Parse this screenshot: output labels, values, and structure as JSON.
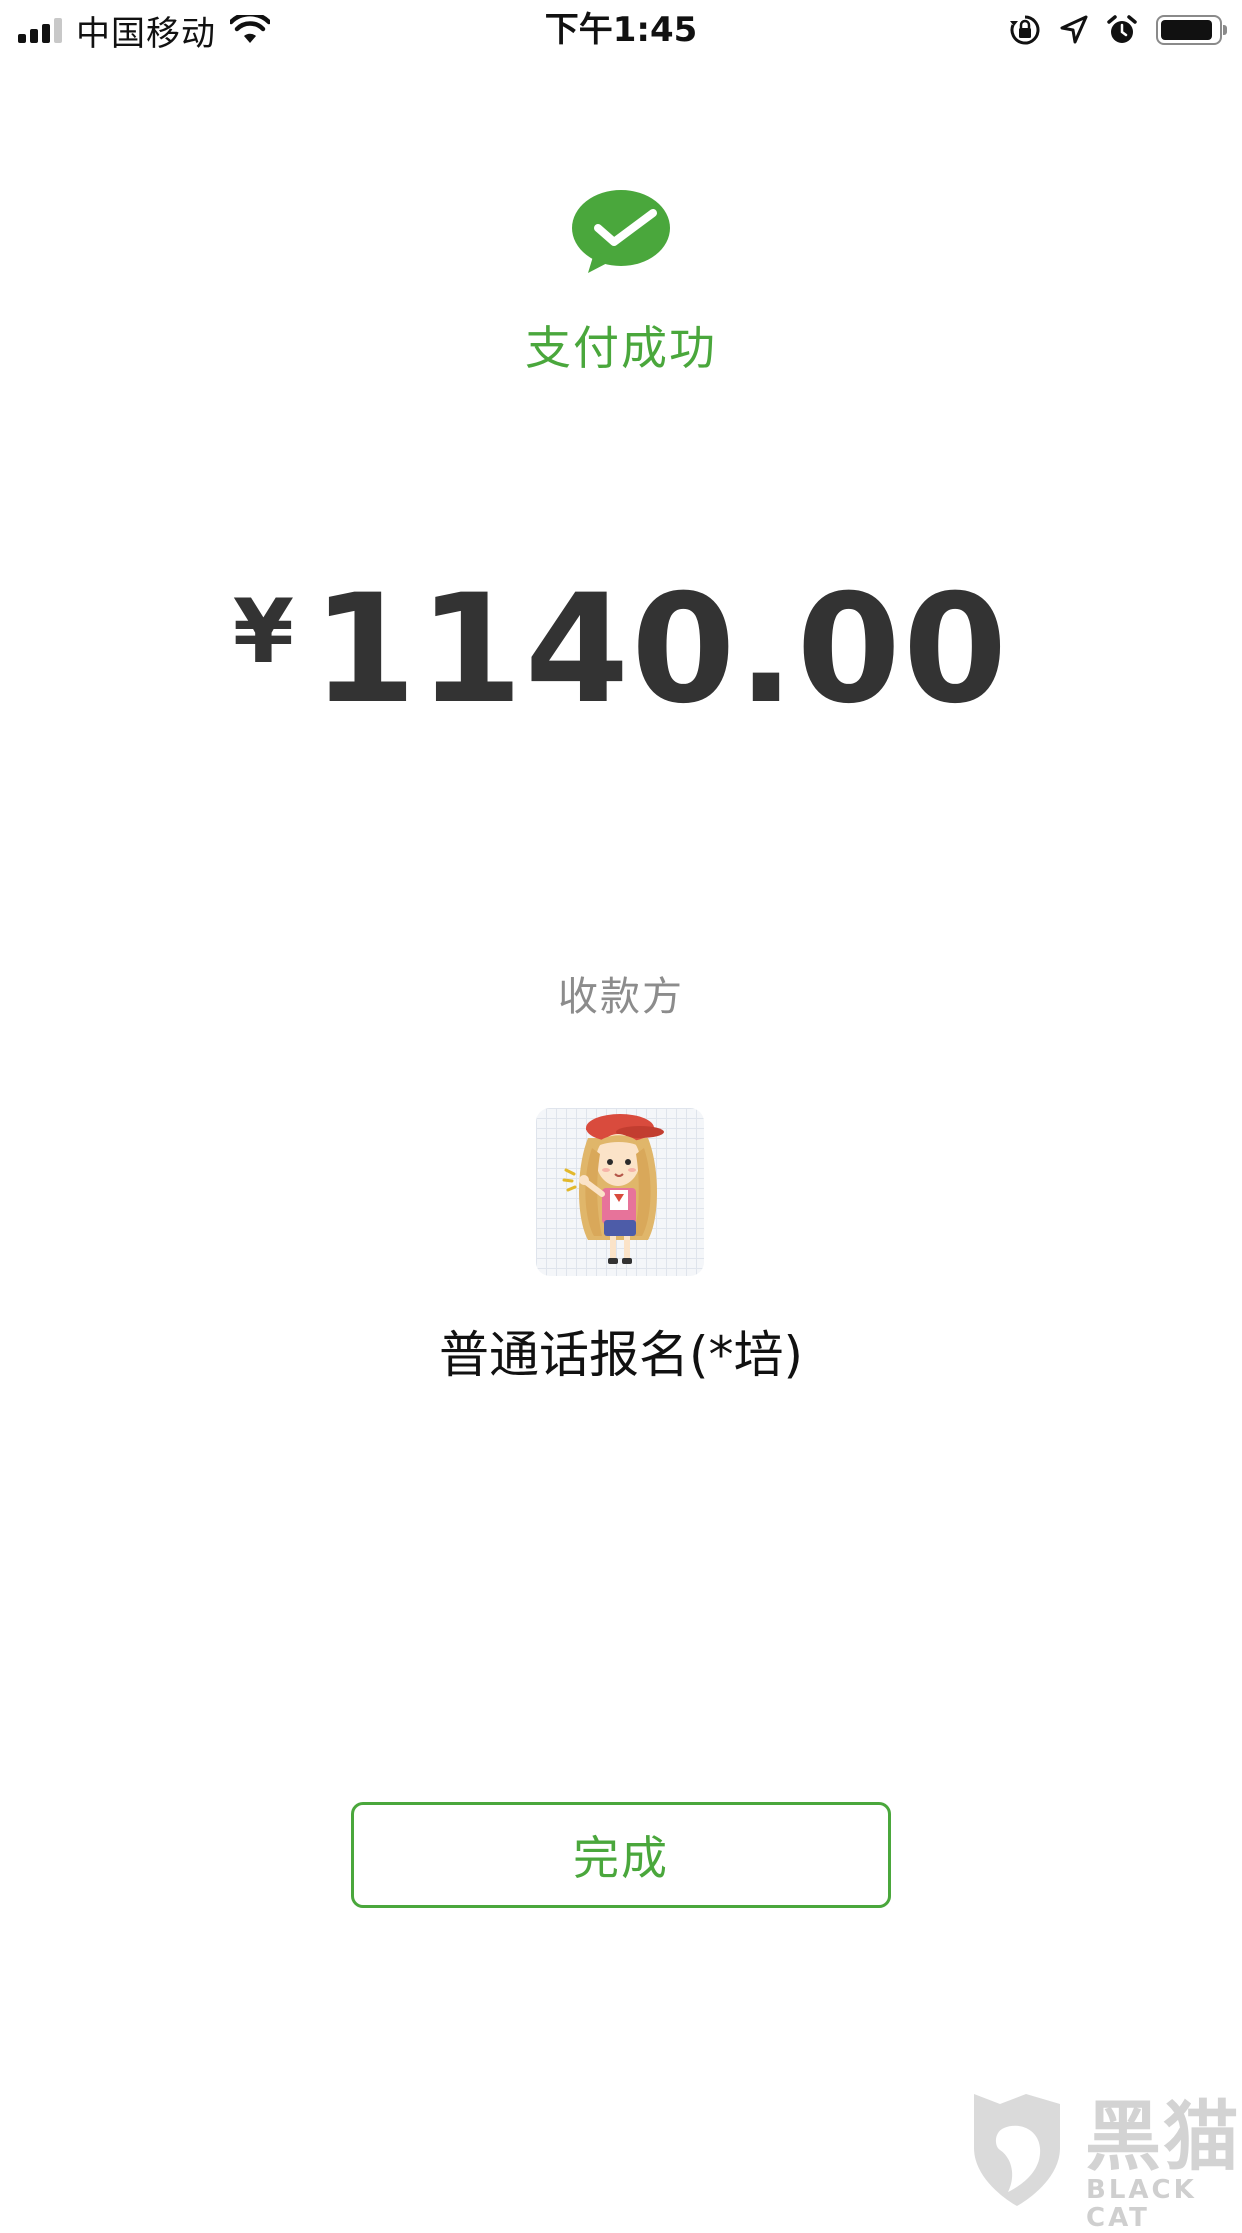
{
  "status_bar": {
    "carrier": "中国移动",
    "time": "下午1:45"
  },
  "payment": {
    "status_text": "支付成功",
    "currency_symbol": "¥",
    "amount": "1140.00"
  },
  "payee": {
    "label": "收款方",
    "name": "普通话报名(*培)"
  },
  "actions": {
    "done_label": "完成"
  },
  "watermark": {
    "brand": "黑猫",
    "brand_en": "BLACK CAT"
  },
  "colors": {
    "accent": "#4aa73c",
    "amount_text": "#333333",
    "muted_text": "#8c8c8c"
  },
  "icons": {
    "signal": "cellular-signal-icon",
    "wifi": "wifi-icon",
    "orientation_lock": "orientation-lock-icon",
    "location": "location-arrow-icon",
    "alarm": "alarm-clock-icon",
    "battery": "battery-icon",
    "success": "wechat-pay-check-icon"
  }
}
